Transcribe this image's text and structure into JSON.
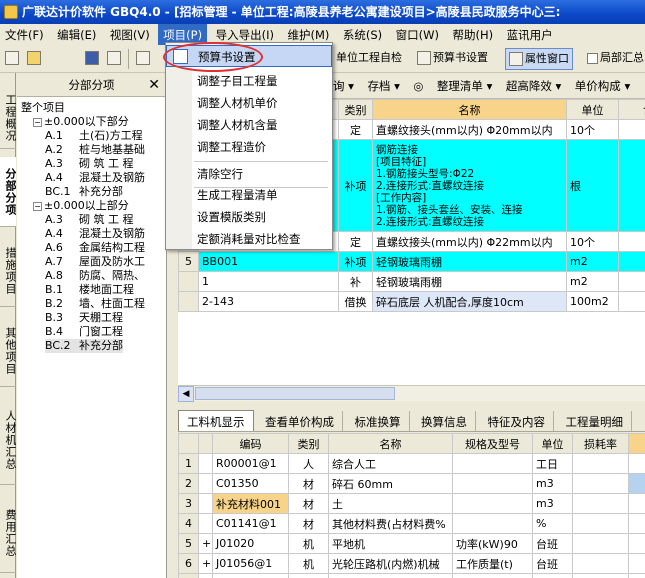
{
  "window": {
    "title": "广联达计价软件 GBQ4.0 - [招标管理 - 单位工程:高陵县养老公寓建设项目>高陵县民政服务中心三:"
  },
  "menubar": [
    "文件(F)",
    "编辑(E)",
    "视图(V)",
    "项目(P)",
    "导入导出(I)",
    "维护(M)",
    "系统(S)",
    "窗口(W)",
    "帮助(H)",
    "蓝讯用户"
  ],
  "toolbar": {
    "check_label": "单位工程自检",
    "budget_setting_label": "预算书设置",
    "property_window_label": "属性窗口",
    "local_summary_label": "局部汇总"
  },
  "sidebar_tabs": [
    "工程概况",
    "分部分项",
    "措施项目",
    "其他项目",
    "人材机汇总",
    "费用汇总"
  ],
  "tree": {
    "header": "分部分项",
    "items": [
      {
        "code": "",
        "label": "整个项目",
        "level": 0,
        "toggle": ""
      },
      {
        "code": "",
        "label": "±0.000以下部分",
        "level": 1,
        "toggle": "−"
      },
      {
        "code": "A.1",
        "label": "土(石)方工程",
        "level": 2,
        "toggle": ""
      },
      {
        "code": "A.2",
        "label": "桩与地基基础",
        "level": 2,
        "toggle": ""
      },
      {
        "code": "A.3",
        "label": "砌 筑 工 程",
        "level": 2,
        "toggle": ""
      },
      {
        "code": "A.4",
        "label": "混凝土及钢筋",
        "level": 2,
        "toggle": ""
      },
      {
        "code": "BC.1",
        "label": "补充分部",
        "level": 2,
        "toggle": ""
      },
      {
        "code": "",
        "label": "±0.000以上部分",
        "level": 1,
        "toggle": "−"
      },
      {
        "code": "A.3",
        "label": "砌 筑 工 程",
        "level": 2,
        "toggle": ""
      },
      {
        "code": "A.4",
        "label": "混凝土及钢筋",
        "level": 2,
        "toggle": ""
      },
      {
        "code": "A.6",
        "label": "金属结构工程",
        "level": 2,
        "toggle": ""
      },
      {
        "code": "A.7",
        "label": "屋面及防水工",
        "level": 2,
        "toggle": ""
      },
      {
        "code": "A.8",
        "label": "防腐、隔热、",
        "level": 2,
        "toggle": ""
      },
      {
        "code": "B.1",
        "label": "楼地面工程",
        "level": 2,
        "toggle": ""
      },
      {
        "code": "B.2",
        "label": "墙、柱面工程",
        "level": 2,
        "toggle": ""
      },
      {
        "code": "B.3",
        "label": "天棚工程",
        "level": 2,
        "toggle": ""
      },
      {
        "code": "B.4",
        "label": "门窗工程",
        "level": 2,
        "toggle": ""
      },
      {
        "code": "BC.2",
        "label": "补充分部",
        "level": 2,
        "toggle": ""
      }
    ]
  },
  "subtoolbar": [
    "询 ▾",
    "存档 ▾",
    "整理清单 ▾",
    "超高降效 ▾",
    "单价构成 ▾"
  ],
  "upper_grid": {
    "headers": [
      "类别",
      "名称",
      "单位",
      "含"
    ],
    "rows": [
      {
        "rn": "",
        "code": "",
        "type": "定",
        "name": "直螺纹接头(mm以内) Φ20mm以内",
        "unit": "10个",
        "style": ""
      },
      {
        "rn": "",
        "code": "",
        "type": "补项",
        "name": "钢筋连接\n[项目特征]\n1.钢筋接头型号:Φ22\n2.连接形式:直螺纹连接\n[工作内容]\n1.钢筋、接头套丝、安装、连接\n2.连接形式:直螺纹连接",
        "unit": "根",
        "style": "cyan-tall"
      },
      {
        "rn": "",
        "code": "",
        "type": "定",
        "name": "直螺纹接头(mm以内) Φ22mm以内",
        "unit": "10个",
        "style": ""
      },
      {
        "rn": "5",
        "code": "BB001",
        "type": "补项",
        "name": "轻钢玻璃雨棚",
        "unit": "m2",
        "style": "cyan"
      },
      {
        "rn": "",
        "code": "1",
        "type": "补",
        "name": "轻钢玻璃雨棚",
        "unit": "m2",
        "style": ""
      },
      {
        "rn": "",
        "code": "2-143",
        "type": "借换",
        "name": "碎石底层 人机配合,厚度10cm",
        "unit": "100m2",
        "style": "hl"
      }
    ]
  },
  "lower_tabs": [
    "工料机显示",
    "查看单价构成",
    "标准换算",
    "换算信息",
    "特征及内容",
    "工程量明细"
  ],
  "lower_grid": {
    "headers": [
      "编码",
      "类别",
      "名称",
      "规格及型号",
      "单位",
      "损耗率"
    ],
    "rows": [
      {
        "rn": "1",
        "toggle": "",
        "code": "R00001@1",
        "type": "人",
        "name": "综合人工",
        "spec": "",
        "unit": "工日"
      },
      {
        "rn": "2",
        "toggle": "",
        "code": "C01350",
        "type": "材",
        "name": "碎石 60mm",
        "spec": "",
        "unit": "m3"
      },
      {
        "rn": "3",
        "toggle": "",
        "code": "补充材料001",
        "type": "材",
        "name": "土",
        "spec": "",
        "unit": "m3"
      },
      {
        "rn": "4",
        "toggle": "",
        "code": "C01141@1",
        "type": "材",
        "name": "其他材料费(占材料费%",
        "spec": "",
        "unit": "%"
      },
      {
        "rn": "5",
        "toggle": "+",
        "code": "J01020",
        "type": "机",
        "name": "平地机",
        "spec": "功率(kW)90",
        "unit": "台班"
      },
      {
        "rn": "6",
        "toggle": "+",
        "code": "J01056@1",
        "type": "机",
        "name": "光轮压路机(内燃)机械",
        "spec": "工作质量(t)",
        "unit": "台班"
      },
      {
        "rn": "7",
        "toggle": "+",
        "code": "J01058",
        "type": "机",
        "name": "光轮压路机(内燃)机械",
        "spec": "工作质量(t)",
        "unit": "台班"
      }
    ]
  },
  "project_menu": {
    "items": [
      "预算书设置",
      "调整子目工程量",
      "调整人材机单价",
      "调整人材机含量",
      "调整工程造价",
      "清除空行",
      "生成工程量清单",
      "设置模版类别",
      "定额消耗量对比检查"
    ]
  },
  "colors": {
    "highlight_cyan": "#00ffff",
    "menu_select": "#316ac5",
    "annotation_red": "#e03030"
  }
}
